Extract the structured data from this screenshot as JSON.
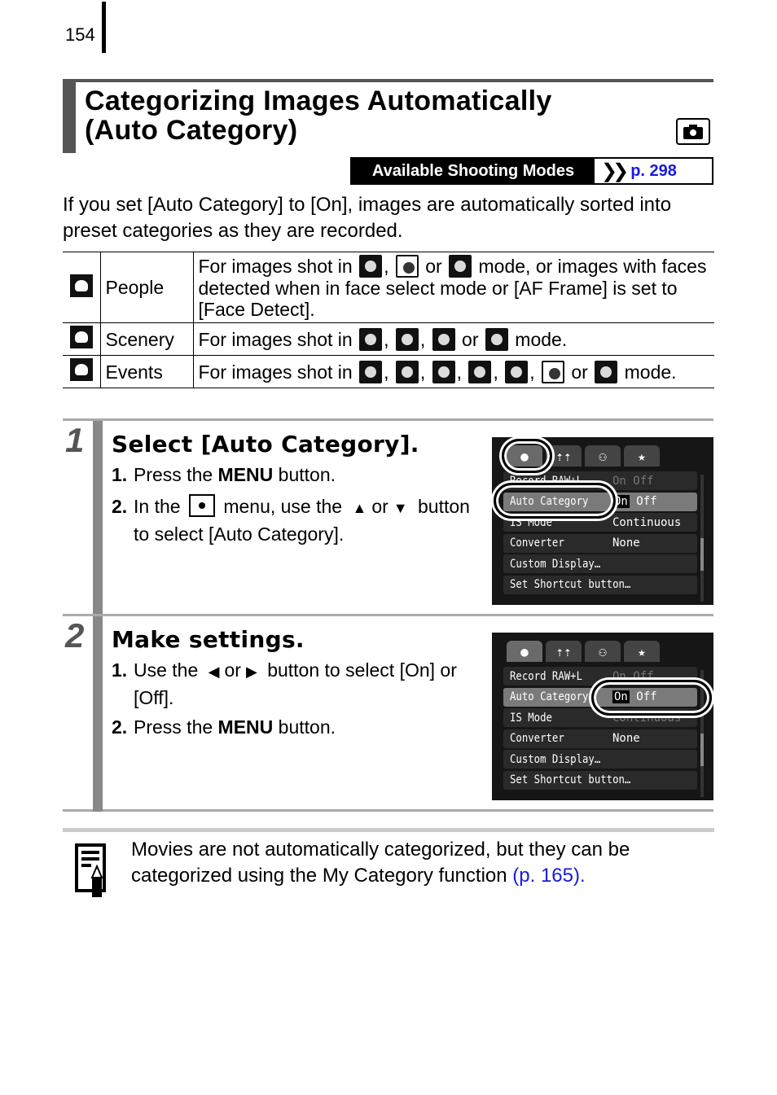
{
  "page": {
    "number": "154",
    "title_line1": "Categorizing Images Automatically",
    "title_line2": "(Auto Category)",
    "title_badge_icon": "camera-icon"
  },
  "modes_bar": {
    "label": "Available Shooting Modes",
    "link": "p. 298"
  },
  "intro": "If you set [Auto Category] to [On], images are automatically sorted into preset categories as they are recorded.",
  "categories": [
    {
      "icon": "people-category-icon",
      "name": "People",
      "desc_prefix": "For images shot in",
      "modes": [
        "portrait-mode-icon",
        "kids-pets-mode-icon",
        "indoor-mode-icon"
      ],
      "desc_suffix": "mode, or images with faces detected when in face select mode or [AF Frame] is set to [Face Detect].",
      "connector": "or"
    },
    {
      "icon": "scenery-category-icon",
      "name": "Scenery",
      "desc_prefix": "For images shot in",
      "modes": [
        "landscape-mode-icon",
        "night-scene-mode-icon",
        "foliage-mode-icon",
        "sunset-mode-icon"
      ],
      "desc_suffix": "mode.",
      "connector": "or"
    },
    {
      "icon": "events-category-icon",
      "name": "Events",
      "desc_prefix": "For images shot in",
      "modes": [
        "sports-mode-icon",
        "party-mode-icon",
        "snow-mode-icon",
        "beach-mode-icon",
        "fireworks-mode-icon",
        "aquarium-mode-icon",
        "underwater-mode-icon"
      ],
      "desc_suffix": "mode.",
      "connector": "or"
    }
  ],
  "steps": [
    {
      "number": "1",
      "title": "Select [Auto Category].",
      "items": [
        {
          "n": "1.",
          "pre": "Press the ",
          "bold": "MENU",
          "post": " button."
        },
        {
          "n": "2.",
          "pre": "In the",
          "mid": "menu, use the",
          "or": "or",
          "post": "button to select [Auto Category]."
        }
      ],
      "screen": {
        "tabs": [
          "camera-tab",
          "settings-tab",
          "my-menu-tab",
          "favorites-tab"
        ],
        "rows": [
          {
            "label": "Record RAW+L",
            "value": "On  Off"
          },
          {
            "label": "Auto Category",
            "value_on": "On",
            "value_off": "Off",
            "selected": true
          },
          {
            "label": "IS Mode",
            "value": "Continuous"
          },
          {
            "label": "Converter",
            "value": "None"
          },
          {
            "label": "Custom Display…",
            "value": ""
          },
          {
            "label": "Set Shortcut button…",
            "value": ""
          }
        ]
      }
    },
    {
      "number": "2",
      "title": "Make settings.",
      "items": [
        {
          "n": "1.",
          "pre": "Use the",
          "or": "or",
          "post": "button to select [On] or [Off]."
        },
        {
          "n": "2.",
          "pre": "Press the ",
          "bold": "MENU",
          "post": " button."
        }
      ],
      "screen": {
        "rows": [
          {
            "label": "Record RAW+L",
            "value": "On  Off"
          },
          {
            "label": "Auto Category",
            "value_on": "On",
            "value_off": "Off",
            "selected": true
          },
          {
            "label": "IS Mode",
            "value": "Continuous"
          },
          {
            "label": "Converter",
            "value": "None"
          },
          {
            "label": "Custom Display…",
            "value": ""
          },
          {
            "label": "Set Shortcut button…",
            "value": ""
          }
        ]
      }
    }
  ],
  "note": {
    "text": "Movies are not automatically categorized, but they can be categorized using the My Category function ",
    "link": "(p. 165)",
    "tail": "."
  },
  "colors": {
    "link": "#1a1adc",
    "title_bar": "#555555",
    "step_bar": "#888888"
  }
}
